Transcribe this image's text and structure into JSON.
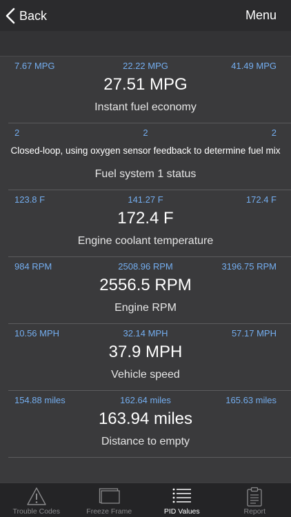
{
  "navbar": {
    "back_label": "Back",
    "menu_label": "Menu"
  },
  "pids": [
    {
      "min": "7.67 MPG",
      "avg": "22.22 MPG",
      "max": "41.49 MPG",
      "value": "27.51 MPG",
      "name": "Instant fuel economy"
    },
    {
      "min": "2",
      "avg": "2",
      "max": "2",
      "value": "Closed-loop, using oxygen sensor feedback to determine fuel mix",
      "name": "Fuel system 1 status"
    },
    {
      "min": "123.8 F",
      "avg": "141.27 F",
      "max": "172.4 F",
      "value": "172.4 F",
      "name": "Engine coolant temperature"
    },
    {
      "min": "984 RPM",
      "avg": "2508.96 RPM",
      "max": "3196.75 RPM",
      "value": "2556.5 RPM",
      "name": "Engine RPM"
    },
    {
      "min": "10.56 MPH",
      "avg": "32.14 MPH",
      "max": "57.17 MPH",
      "value": "37.9 MPH",
      "name": "Vehicle speed"
    },
    {
      "min": "154.88 miles",
      "avg": "162.64 miles",
      "max": "165.63 miles",
      "value": "163.94 miles",
      "name": "Distance to empty"
    }
  ],
  "tabs": [
    {
      "label": "Trouble Codes",
      "icon": "warning-triangle-icon",
      "active": false
    },
    {
      "label": "Freeze Frame",
      "icon": "stacked-frames-icon",
      "active": false
    },
    {
      "label": "PID Values",
      "icon": "list-icon",
      "active": true
    },
    {
      "label": "Report",
      "icon": "clipboard-icon",
      "active": false
    }
  ],
  "colors": {
    "background": "#3a3a3c",
    "navbar": "#2b2b2d",
    "accent_blue": "#74aef0",
    "tabbar": "#242426",
    "tab_inactive": "#8a8a8c"
  }
}
